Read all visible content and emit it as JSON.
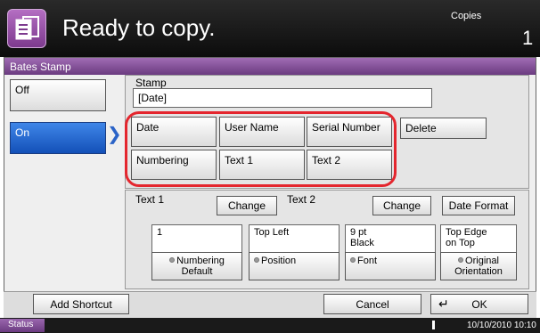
{
  "header": {
    "title": "Ready to copy.",
    "copies_label": "Copies",
    "copies_value": "1"
  },
  "panel": {
    "title": "Bates Stamp"
  },
  "mode": {
    "off_label": "Off",
    "on_label": "On",
    "selected": "On"
  },
  "stamp": {
    "label": "Stamp",
    "value": "[Date]",
    "buttons": [
      "Date",
      "User Name",
      "Serial Number",
      "Numbering",
      "Text 1",
      "Text 2"
    ],
    "delete_label": "Delete"
  },
  "settings": {
    "text1_label": "Text 1",
    "text1_change": "Change",
    "text2_label": "Text 2",
    "text2_change": "Change",
    "date_format": "Date Format",
    "numbering": {
      "value": "1",
      "button_line1": "Numbering",
      "button_line2": "Default"
    },
    "position": {
      "value": "Top Left",
      "button": "Position"
    },
    "font": {
      "value_line1": "9 pt",
      "value_line2": "Black",
      "button": "Font"
    },
    "orientation": {
      "value_line1": "Top Edge",
      "value_line2": "on Top",
      "button_line1": "Original",
      "button_line2": "Orientation"
    }
  },
  "bottom": {
    "add_shortcut": "Add Shortcut",
    "cancel": "Cancel",
    "ok": "OK"
  },
  "status": {
    "label": "Status",
    "datetime": "10/10/2010  10:10"
  },
  "colors": {
    "accent": "#7d3a8e",
    "selected": "#1350b8",
    "highlight": "#e4262e"
  }
}
